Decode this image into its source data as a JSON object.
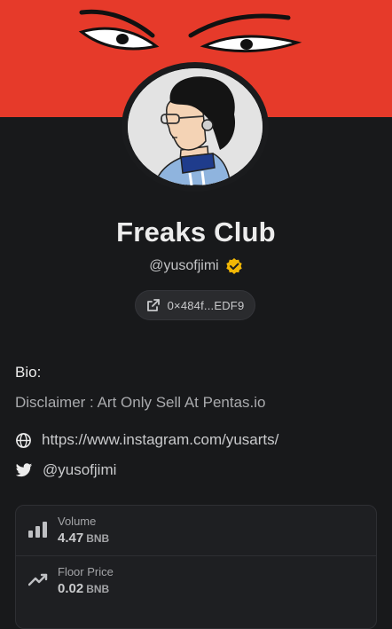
{
  "profile": {
    "name": "Freaks Club",
    "handle": "@yusofjimi",
    "verified": true,
    "address": "0×484f...EDF9"
  },
  "bio": {
    "label": "Bio:",
    "text": "Disclaimer : Art Only Sell At Pentas.io"
  },
  "links": {
    "website": "https://www.instagram.com/yusarts/",
    "twitter": "@yusofjimi"
  },
  "stats": [
    {
      "label": "Volume",
      "value": "4.47",
      "unit": "BNB",
      "icon": "bar-chart-icon"
    },
    {
      "label": "Floor Price",
      "value": "0.02",
      "unit": "BNB",
      "icon": "trending-up-icon"
    }
  ],
  "colors": {
    "banner": "#e63a2a",
    "background": "#18191b",
    "verified": "#f2b705"
  }
}
